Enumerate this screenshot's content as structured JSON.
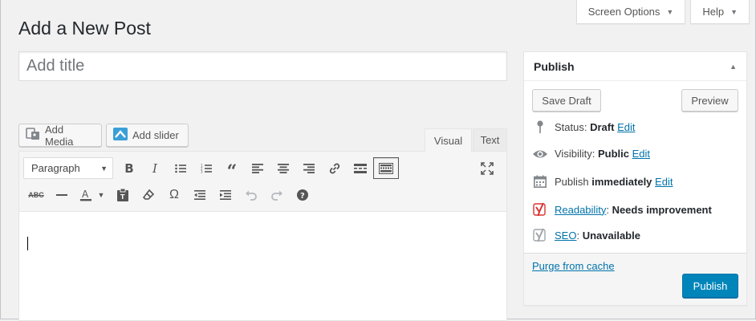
{
  "meta": {
    "screen_options_label": "Screen Options",
    "help_label": "Help"
  },
  "page": {
    "title": "Add a New Post"
  },
  "post_title": {
    "value": "",
    "placeholder": "Add title"
  },
  "media": {
    "add_media_label": "Add Media",
    "add_slider_label": "Add slider"
  },
  "editor_tabs": {
    "visual_label": "Visual",
    "text_label": "Text",
    "active": "Visual"
  },
  "toolbar": {
    "format_selected": "Paragraph",
    "row1_icons": [
      "bold-icon",
      "italic-icon",
      "bullet-list-icon",
      "numbered-list-icon",
      "blockquote-icon",
      "align-left-icon",
      "align-center-icon",
      "align-right-icon",
      "link-icon",
      "read-more-icon",
      "toolbar-toggle-icon"
    ],
    "row2_icons": [
      "strikethrough-icon",
      "horizontal-line-icon",
      "text-color-icon",
      "paste-text-icon",
      "clear-formatting-icon",
      "special-character-icon",
      "outdent-icon",
      "indent-icon",
      "undo-icon",
      "redo-icon",
      "help-icon"
    ],
    "fullscreen_icon": "fullscreen-icon"
  },
  "publish": {
    "heading": "Publish",
    "save_draft_label": "Save Draft",
    "preview_label": "Preview",
    "status_label": "Status:",
    "status_value": "Draft",
    "visibility_label": "Visibility:",
    "visibility_value": "Public",
    "publish_label": "Publish",
    "publish_value": "immediately",
    "edit_label": "Edit",
    "readability_label": "Readability",
    "readability_value": "Needs improvement",
    "seo_label": "SEO",
    "seo_value": "Unavailable",
    "purge_label": "Purge from cache",
    "publish_button_label": "Publish"
  },
  "colors": {
    "primary": "#0085ba",
    "link": "#0073aa",
    "yoast_red": "#dc3232",
    "background": "#f1f1f1"
  }
}
